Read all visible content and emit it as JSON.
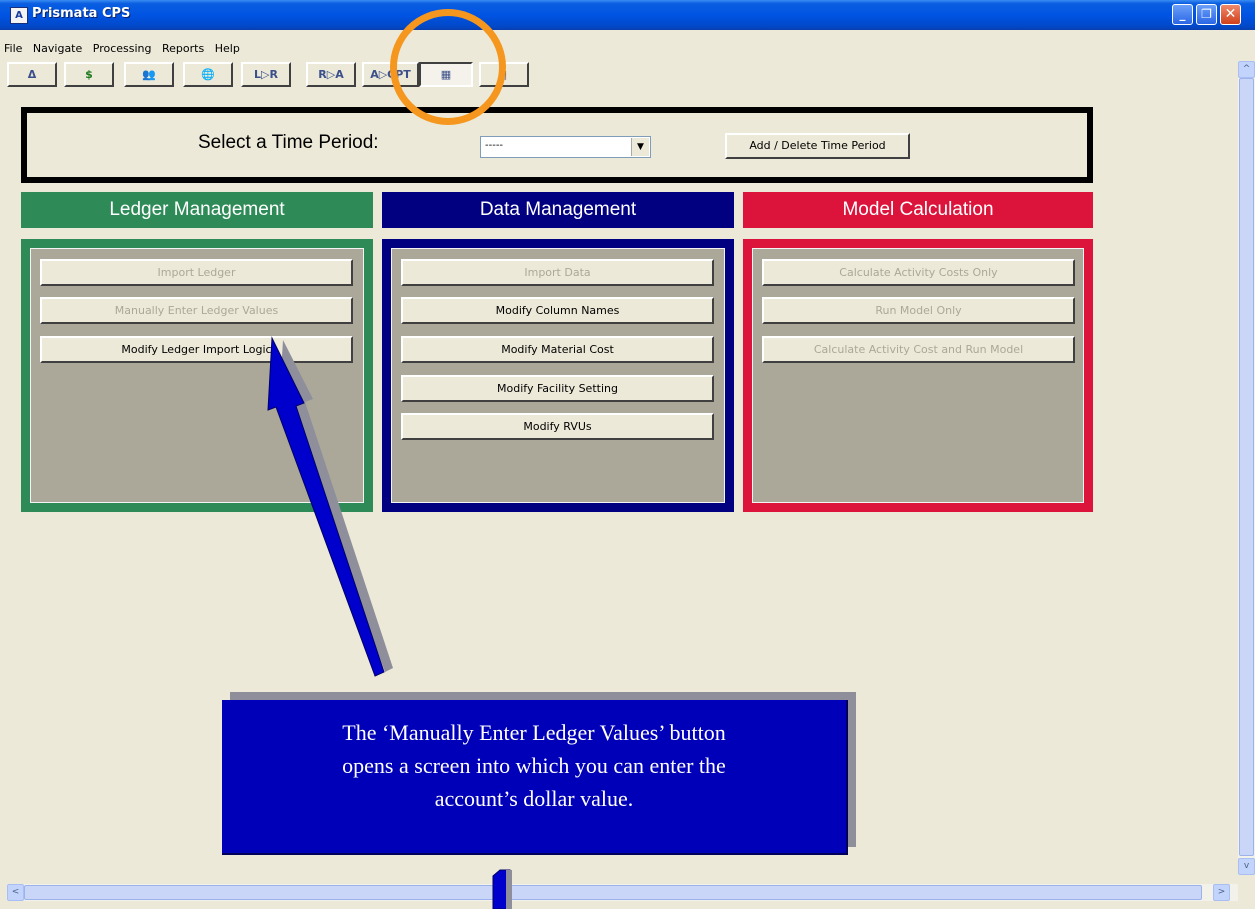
{
  "window": {
    "title": "Prismata CPS",
    "icon_text": "A",
    "controls": [
      "_",
      "❐",
      "✕"
    ]
  },
  "menu": [
    "File",
    "Navigate",
    "Processing",
    "Reports",
    "Help"
  ],
  "toolbar": [
    {
      "name": "delta-button",
      "label": "Δ"
    },
    {
      "name": "dollar-button",
      "label": "$"
    },
    {
      "name": "people-button",
      "label": "👥"
    },
    {
      "name": "globe-user-button",
      "label": "🌐"
    },
    {
      "name": "l-to-r-button",
      "label": "L▷R"
    },
    {
      "name": "r-to-a-button",
      "label": "R▷A"
    },
    {
      "name": "a-to-cpt-button",
      "label": "A▷CPT"
    },
    {
      "name": "calculator-button",
      "label": "▦"
    },
    {
      "name": "document-button",
      "label": "▯"
    }
  ],
  "time_period": {
    "label": "Select a Time Period:",
    "selected": "-----",
    "add_delete_label": "Add / Delete Time Period"
  },
  "sections": {
    "ledger": {
      "title": "Ledger Management",
      "color": "#2e8b57",
      "buttons": [
        "Import Ledger",
        "Manually Enter Ledger Values",
        "Modify Ledger Import Logic"
      ]
    },
    "data": {
      "title": "Data Management",
      "color": "#000080",
      "buttons": [
        "Import Data",
        "Modify Column Names",
        "Modify Material Cost",
        "Modify Facility Setting",
        "Modify RVUs"
      ]
    },
    "model": {
      "title": "Model Calculation",
      "color": "#dc143c",
      "buttons": [
        "Calculate Activity Costs Only",
        "Run Model Only",
        "Calculate Activity Cost and Run Model"
      ]
    }
  },
  "callout": {
    "lines": [
      "The ‘Manually Enter Ledger Values’ button",
      "opens a screen into which you can enter the",
      "account’s dollar value."
    ]
  },
  "scroll": {
    "up": "^",
    "down": "v",
    "left": "<",
    "right": ">"
  }
}
